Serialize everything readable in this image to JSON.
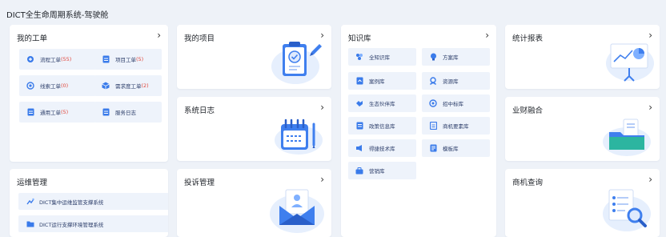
{
  "page": {
    "title": "DICT全生命周期系统-驾驶舱"
  },
  "work_orders": {
    "title": "我的工单",
    "arrow": "›",
    "items": [
      {
        "label": "流程工单",
        "count": "(55)",
        "icon": "flow-icon"
      },
      {
        "label": "项目工单",
        "count": "(5)",
        "icon": "doc-icon"
      },
      {
        "label": "线索工单",
        "count": "(0)",
        "icon": "target-icon"
      },
      {
        "label": "需求度工单",
        "count": "(2)",
        "icon": "cube-icon"
      },
      {
        "label": "通用工单",
        "count": "(5)",
        "icon": "doc-icon"
      },
      {
        "label": "服务日志",
        "count": "",
        "icon": "doc-icon"
      }
    ]
  },
  "my_projects": {
    "title": "我的项目",
    "arrow": "›"
  },
  "system_log": {
    "title": "系统日志",
    "arrow": "›"
  },
  "complaints": {
    "title": "投诉管理",
    "arrow": "›"
  },
  "knowledge": {
    "title": "知识库",
    "arrow": "›",
    "items": [
      {
        "label": "全知识库",
        "icon": "apps-icon"
      },
      {
        "label": "方案库",
        "icon": "bulb-icon"
      },
      {
        "label": "案例库",
        "icon": "case-icon"
      },
      {
        "label": "资源库",
        "icon": "resource-icon"
      },
      {
        "label": "生态伙伴库",
        "icon": "handshake-icon"
      },
      {
        "label": "招中标库",
        "icon": "bid-icon"
      },
      {
        "label": "政策信息库",
        "icon": "policy-icon"
      },
      {
        "label": "商机要素库",
        "icon": "element-icon"
      },
      {
        "label": "得捷技术库",
        "icon": "tech-icon"
      },
      {
        "label": "模板库",
        "icon": "template-icon"
      },
      {
        "label": "营销库",
        "icon": "marketing-icon"
      }
    ]
  },
  "statistics": {
    "title": "统计报表",
    "arrow": "›"
  },
  "finance": {
    "title": "业财融合",
    "arrow": "›"
  },
  "opportunity": {
    "title": "商机查询",
    "arrow": "›"
  },
  "operations": {
    "title": "运维管理",
    "items": [
      {
        "label": "DICT集中运维监管支撑系统",
        "icon": "monitor-icon"
      },
      {
        "label": "DICT运行支撑环境管理系统",
        "icon": "folder-icon"
      }
    ]
  },
  "colors": {
    "accent": "#2f6fe0",
    "tile_bg": "#eef3fb",
    "count_red": "#e0473c",
    "page_bg": "#eef2f8"
  }
}
